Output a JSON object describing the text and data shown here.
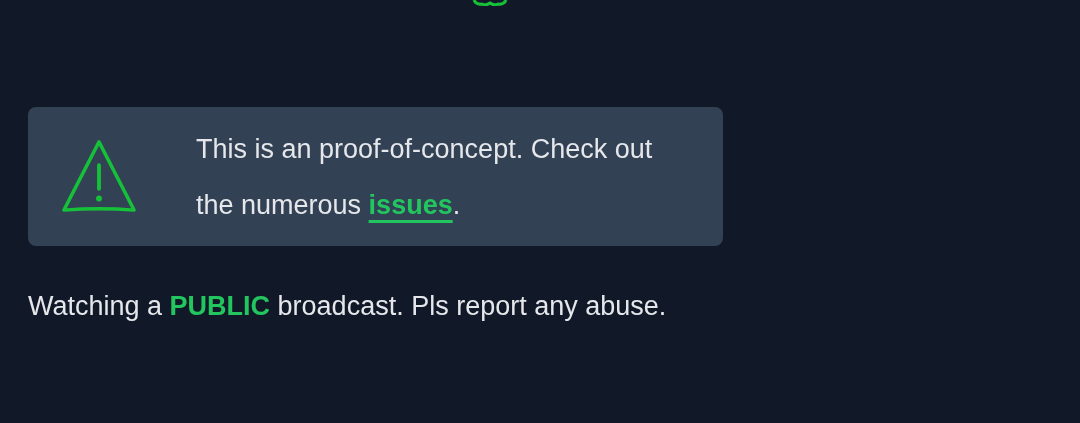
{
  "alert": {
    "text_before": "This is an proof-of-concept. Check out the numerous ",
    "link": "issues",
    "text_after": "."
  },
  "notice": "Watching a **PUBLIC** broadcast. Pls report any abuse."
}
